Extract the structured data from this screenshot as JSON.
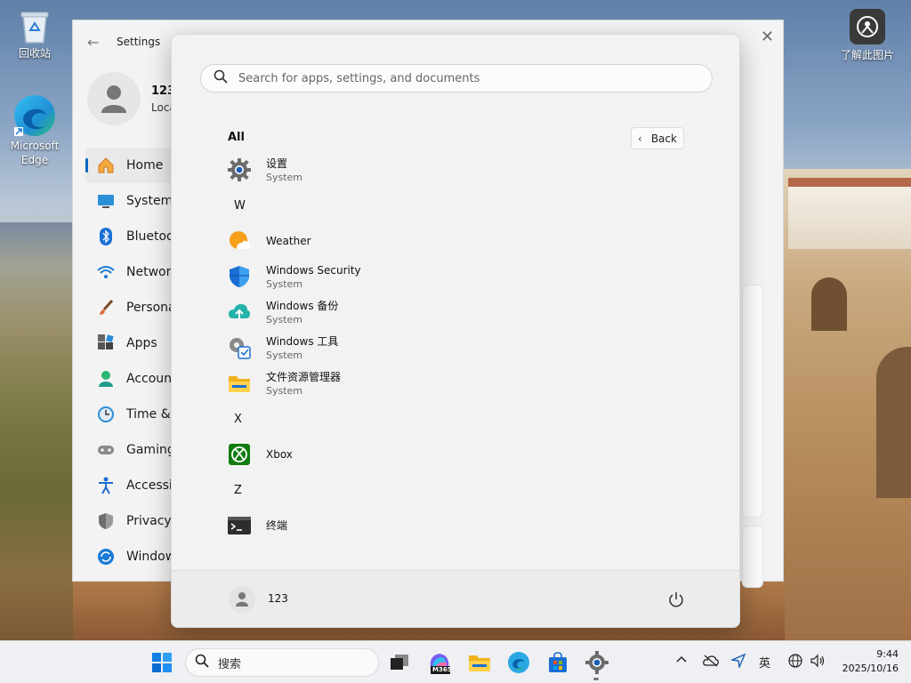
{
  "desktop": {
    "icons": [
      {
        "label": "回收站",
        "icon": "recycle-bin-icon"
      },
      {
        "label": "Microsoft Edge",
        "icon": "edge-icon"
      },
      {
        "label": "了解此图片",
        "icon": "camera-info-icon"
      }
    ]
  },
  "settings": {
    "title": "Settings",
    "profile_name": "123",
    "profile_sub": "Loca",
    "nav": [
      {
        "label": "Home",
        "icon": "home-icon",
        "active": true
      },
      {
        "label": "System",
        "icon": "system-icon"
      },
      {
        "label": "Bluetoot",
        "icon": "bluetooth-icon"
      },
      {
        "label": "Network",
        "icon": "network-icon"
      },
      {
        "label": "Personal",
        "icon": "brush-icon"
      },
      {
        "label": "Apps",
        "icon": "apps-icon"
      },
      {
        "label": "Account",
        "icon": "account-icon"
      },
      {
        "label": "Time & l",
        "icon": "clock-icon"
      },
      {
        "label": "Gaming",
        "icon": "gamepad-icon"
      },
      {
        "label": "Accessib",
        "icon": "accessibility-icon"
      },
      {
        "label": "Privacy &",
        "icon": "shield-icon"
      },
      {
        "label": "Window",
        "icon": "update-icon"
      }
    ]
  },
  "start": {
    "search_placeholder": "Search for apps, settings, and documents",
    "all_label": "All",
    "back_label": "Back",
    "list": [
      {
        "type": "app",
        "name": "设置",
        "sub": "System",
        "icon": "settings-gear-icon"
      },
      {
        "type": "letter",
        "name": "W"
      },
      {
        "type": "app",
        "name": "Weather",
        "sub": "",
        "icon": "weather-icon"
      },
      {
        "type": "app",
        "name": "Windows Security",
        "sub": "System",
        "icon": "security-shield-icon"
      },
      {
        "type": "app",
        "name": "Windows 备份",
        "sub": "System",
        "icon": "backup-icon"
      },
      {
        "type": "app",
        "name": "Windows 工具",
        "sub": "System",
        "icon": "tools-icon"
      },
      {
        "type": "app",
        "name": "文件资源管理器",
        "sub": "System",
        "icon": "folder-icon"
      },
      {
        "type": "letter",
        "name": "X"
      },
      {
        "type": "app",
        "name": "Xbox",
        "sub": "",
        "icon": "xbox-icon"
      },
      {
        "type": "letter",
        "name": "Z"
      },
      {
        "type": "app",
        "name": "终端",
        "sub": "",
        "icon": "terminal-icon"
      }
    ],
    "user_name": "123"
  },
  "taskbar": {
    "search_label": "搜索",
    "language": "英",
    "time": "9:44",
    "date": "2025/10/16",
    "m365_badge": "M365"
  },
  "colors": {
    "accent": "#0067c0",
    "start_bg": "#f2f2f2",
    "taskbar_bg": "#eef0f3"
  }
}
